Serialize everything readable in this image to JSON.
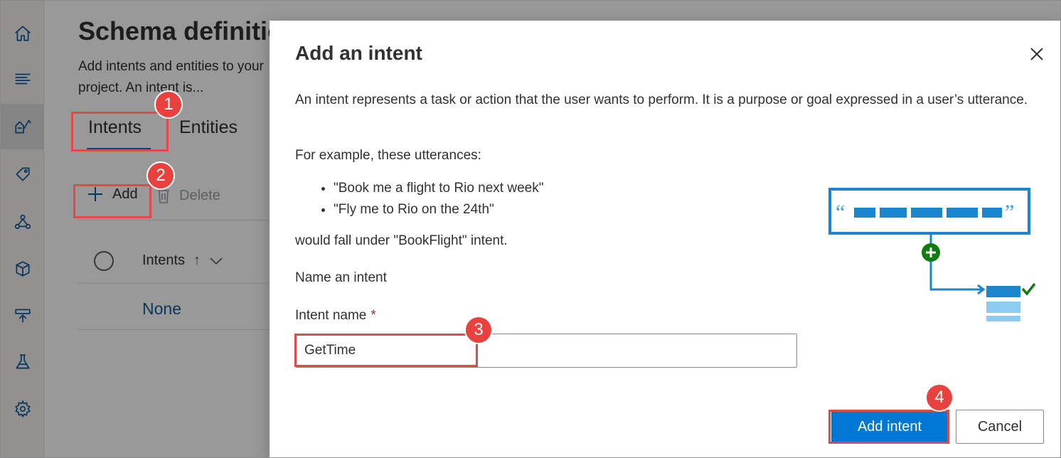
{
  "rail": {
    "items": [
      "home-icon",
      "list-icon",
      "schema-icon",
      "tag-icon",
      "network-icon",
      "cube-icon",
      "deploy-icon",
      "flask-icon",
      "gear-icon"
    ]
  },
  "page": {
    "title": "Schema definition",
    "description": "Add intents and entities to your project. An intent is...",
    "tabs": [
      "Intents",
      "Entities"
    ],
    "toolbar": {
      "add": "Add",
      "delete": "Delete"
    },
    "table": {
      "column": "Intents",
      "sort_indicator": "↑",
      "rows": [
        "None"
      ]
    }
  },
  "dialog": {
    "title": "Add an intent",
    "paragraph1": "An intent represents a task or action that the user wants to perform. It is a purpose or goal expressed in a user’s utterance.",
    "paragraph2": "For example, these utterances:",
    "bullets": [
      "\"Book me a flight to Rio next week\"",
      "\"Fly me to Rio on the 24th\""
    ],
    "paragraph3": "would fall under \"BookFlight\" intent.",
    "section_label": "Name an intent",
    "field_label": "Intent name",
    "required_mark": "*",
    "field_value": "GetTime",
    "primary_button": "Add intent",
    "cancel_button": "Cancel"
  },
  "annotations": [
    "1",
    "2",
    "3",
    "4"
  ],
  "colors": {
    "accent": "#0078d4",
    "annotation": "#e8413e",
    "link": "#0f5b9c"
  }
}
